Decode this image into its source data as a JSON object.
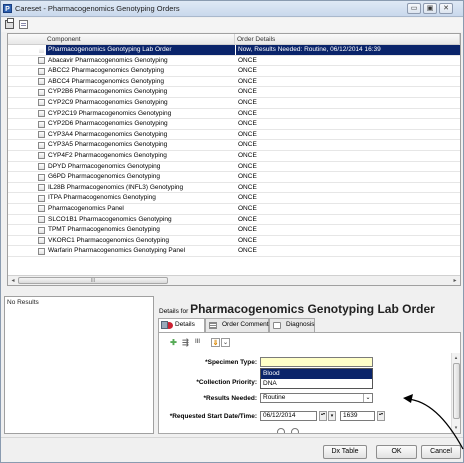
{
  "window": {
    "app_icon_glyph": "P",
    "title": "Careset - Pharmacogenomics Genotyping Orders",
    "controls": [
      "▭",
      "▣",
      "✕"
    ]
  },
  "toolbar": {
    "icons": [
      "printer-icon",
      "document-icon"
    ]
  },
  "grid": {
    "columns": [
      "Component",
      "Order Details"
    ],
    "rows": [
      {
        "component": "Pharmacogenomics Genotyping Lab Order",
        "details": "Now, Results Needed: Routine, 06/12/2014 16:39",
        "selected": true
      },
      {
        "component": "Abacavir Pharmacogenomics Genotyping",
        "details": "ONCE"
      },
      {
        "component": "ABCC2 Pharmacogenomics Genotyping",
        "details": "ONCE"
      },
      {
        "component": "ABCC4 Pharmacogenomics Genotyping",
        "details": "ONCE"
      },
      {
        "component": "CYP2B6 Pharmacogenomics Genotyping",
        "details": "ONCE"
      },
      {
        "component": "CYP2C9 Pharmacogenomics Genotyping",
        "details": "ONCE"
      },
      {
        "component": "CYP2C19 Pharmacogenomics Genotyping",
        "details": "ONCE"
      },
      {
        "component": "CYP2D6 Pharmacogenomics Genotyping",
        "details": "ONCE"
      },
      {
        "component": "CYP3A4 Pharmacogenomics Genotyping",
        "details": "ONCE"
      },
      {
        "component": "CYP3A5 Pharmacogenomics Genotyping",
        "details": "ONCE"
      },
      {
        "component": "CYP4F2 Pharmacogenomics Genotyping",
        "details": "ONCE"
      },
      {
        "component": "DPYD Pharmacogenomics Genotyping",
        "details": "ONCE"
      },
      {
        "component": "G6PD Pharmacogenomics Genotyping",
        "details": "ONCE"
      },
      {
        "component": "IL28B Pharmacogenomics (INFL3) Genotyping",
        "details": "ONCE"
      },
      {
        "component": "ITPA Pharmacogenomics Genotyping",
        "details": "ONCE"
      },
      {
        "component": "Pharmacogenomics Panel",
        "details": "ONCE"
      },
      {
        "component": "SLCO1B1 Pharmacogenomics Genotyping",
        "details": "ONCE"
      },
      {
        "component": "TPMT Pharmacogenomics Genotyping",
        "details": "ONCE"
      },
      {
        "component": "VKORC1 Pharmacogenomics Genotyping",
        "details": "ONCE"
      },
      {
        "component": "Warfarin Pharmacogenomics Genotyping Panel",
        "details": "ONCE"
      }
    ],
    "hscroll": {
      "left": "◂",
      "thumb": "III",
      "right": "▸"
    }
  },
  "results_panel": {
    "label": "No Results"
  },
  "details": {
    "prefix": "Details for ",
    "title": "Pharmacogenomics Genotyping Lab Order",
    "tabs": [
      "Details",
      "Order Comments",
      "Diagnosis"
    ],
    "mini_toolbar": {
      "add": "✚",
      "merge": "⇶",
      "chart": "lll",
      "sort": "⇓",
      "menu": "⌄"
    },
    "fields": {
      "specimen_type": {
        "label": "*Specimen Type:",
        "value": "",
        "arrow": "⌄",
        "options": [
          "Blood",
          "DNA"
        ],
        "highlighted_index": 0
      },
      "collection_priority": {
        "label": "*Collection Priority:"
      },
      "results_needed": {
        "label": "*Results Needed:",
        "value": "Routine",
        "arrow": "⌄"
      },
      "requested_start": {
        "label": "*Requested Start Date/Time:",
        "date": "06/12/2014",
        "time": "1639",
        "spin": "▴▾",
        "drop": "▾"
      }
    },
    "vscroll": {
      "up": "▴",
      "down": "▾"
    }
  },
  "footer": {
    "buttons": [
      "Dx Table",
      "OK",
      "Cancel"
    ]
  },
  "colors": {
    "selection": "#0a246a",
    "required_field": "#ffffc8",
    "annotation_arrow": "#000000"
  }
}
